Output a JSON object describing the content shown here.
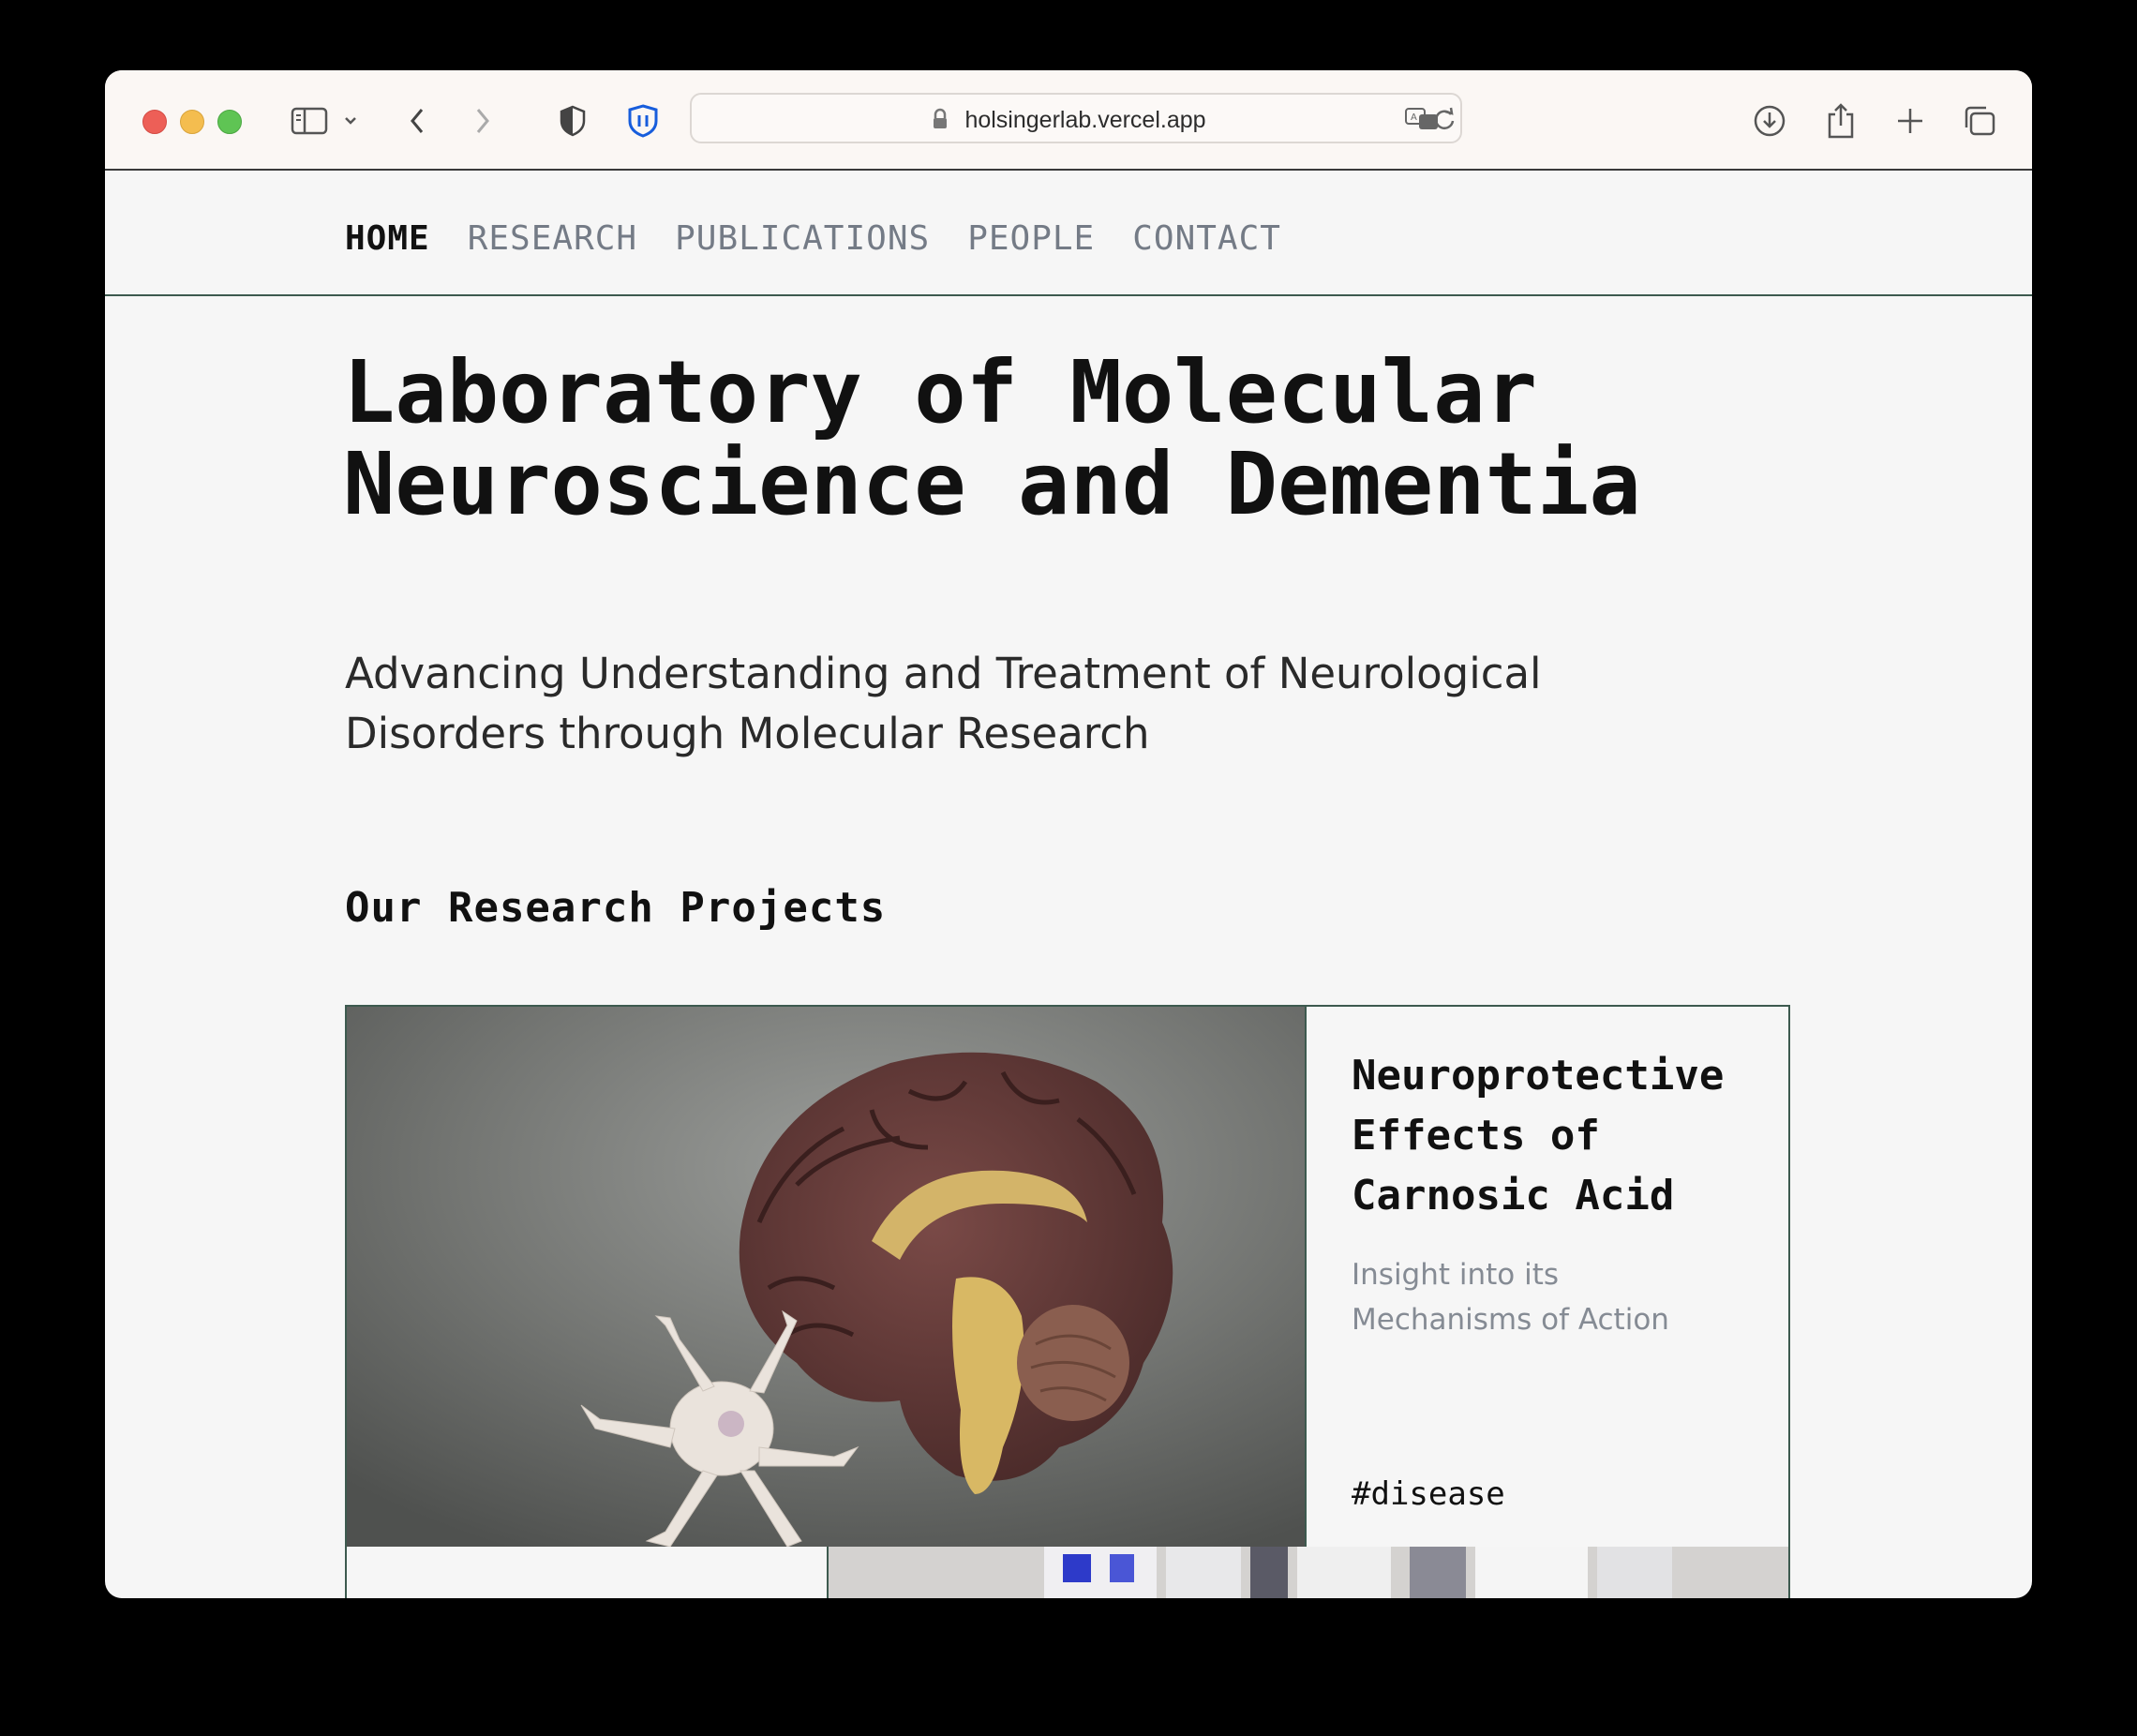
{
  "browser": {
    "url": "holsingerlab.vercel.app"
  },
  "nav": {
    "items": [
      {
        "label": "HOME",
        "active": true
      },
      {
        "label": "RESEARCH",
        "active": false
      },
      {
        "label": "PUBLICATIONS",
        "active": false
      },
      {
        "label": "PEOPLE",
        "active": false
      },
      {
        "label": "CONTACT",
        "active": false
      }
    ]
  },
  "hero": {
    "title_line1": "Laboratory of Molecular",
    "title_line2": "Neuroscience and Dementia",
    "subtitle_line1": "Advancing Understanding and Treatment of Neurological",
    "subtitle_line2": "Disorders through Molecular Research"
  },
  "projects": {
    "section_title": "Our Research Projects",
    "cards": [
      {
        "title_line1": "Neuroprotective",
        "title_line2": "Effects of",
        "title_line3": "Carnosic Acid",
        "desc_line1": "Insight into its",
        "desc_line2": "Mechanisms of Action",
        "tag": "#disease"
      }
    ]
  },
  "colors": {
    "accent_border": "#3d5a4f",
    "nav_inactive": "#747b86",
    "muted_text": "#858b94"
  }
}
